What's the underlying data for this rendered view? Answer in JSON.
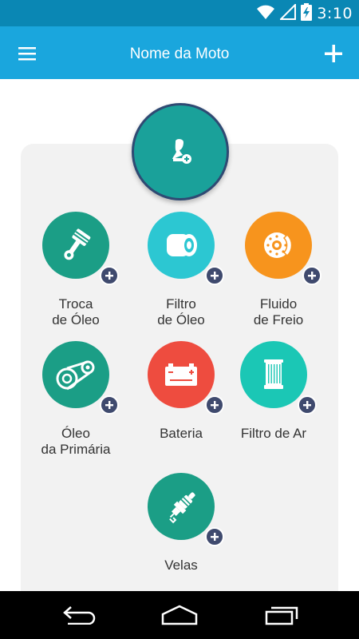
{
  "status_bar": {
    "time": "3:10"
  },
  "app_bar": {
    "title": "Nome da Moto"
  },
  "colors": {
    "status_bar": "#0a87b4",
    "app_bar": "#1aa6dd",
    "teal": "#1b9e86",
    "cyan": "#2cc7d2",
    "orange": "#f7941d",
    "red": "#ee4c3f",
    "mint": "#1bc7b5",
    "badge": "#3f4a6e",
    "avatar_border": "#2f4a73"
  },
  "items": [
    {
      "line1": "Troca",
      "line2": "de Óleo",
      "icon": "piston-icon",
      "color": "#1b9e86"
    },
    {
      "line1": "Filtro",
      "line2": "de Óleo",
      "icon": "oil-filter-icon",
      "color": "#2cc7d2"
    },
    {
      "line1": "Fluido",
      "line2": "de Freio",
      "icon": "brake-disc-icon",
      "color": "#f7941d"
    },
    {
      "line1": "Óleo",
      "line2": "da Primária",
      "icon": "belt-pulley-icon",
      "color": "#1b9e86"
    },
    {
      "line1": "Bateria",
      "line2": "",
      "icon": "battery-icon",
      "color": "#ee4c3f"
    },
    {
      "line1": "Filtro de Ar",
      "line2": "",
      "icon": "air-filter-icon",
      "color": "#1bc7b5"
    },
    {
      "line1": "Velas",
      "line2": "",
      "icon": "spark-plug-icon",
      "color": "#1b9e86"
    }
  ]
}
